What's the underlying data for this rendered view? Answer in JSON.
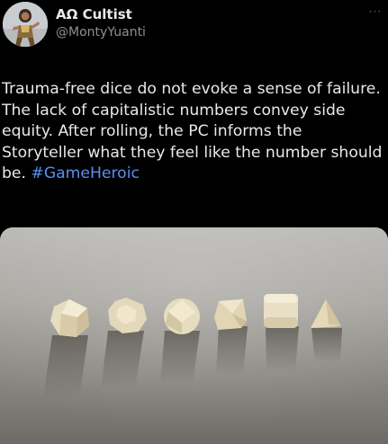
{
  "author": {
    "display_name": "AΩ Cultist",
    "handle": "@MontyYuanti"
  },
  "menu": {
    "icon": "more-horizontal-icon",
    "glyph": "···"
  },
  "tweet": {
    "text": "Trauma-free dice do not evoke a sense of failure. The lack of capitalistic numbers convey side equity. After rolling, the PC informs the Storyteller what they feel like the number should be. ",
    "hashtag": "#GameHeroic"
  },
  "colors": {
    "background": "#000000",
    "text": "#e7e9ea",
    "secondary": "#8b9095",
    "link": "#5a8ff0"
  }
}
